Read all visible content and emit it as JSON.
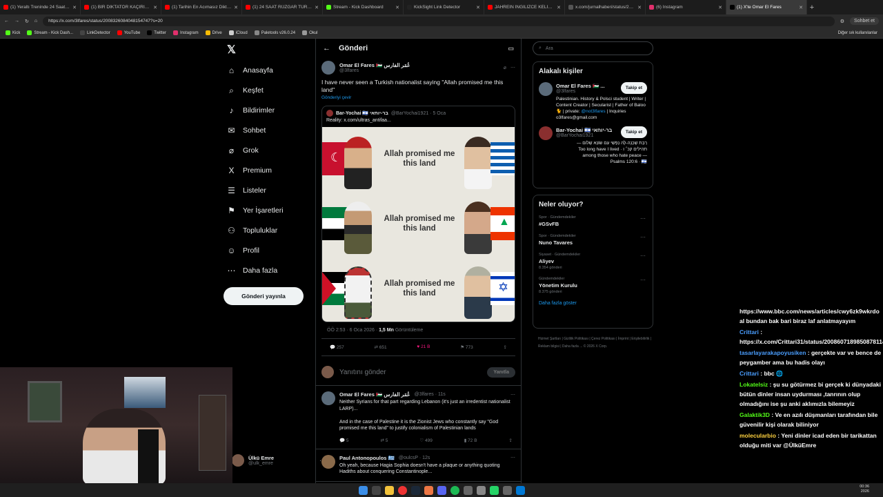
{
  "browser": {
    "tabs": [
      {
        "label": "(1) Yeraltı Treninde 24 Saat Hayat",
        "color": "#ff0000"
      },
      {
        "label": "(1) BİR DİKTATÖR KAÇIRILIRSA NE",
        "color": "#ff0000"
      },
      {
        "label": "(1) Tarihin En Acımasız Diktatör O",
        "color": "#ff0000"
      },
      {
        "label": "(1) 24 SAAT RÜZGAR TÜRBİNİNDE",
        "color": "#ff0000"
      },
      {
        "label": "Stream - Kick Dashboard",
        "color": "#53fc18"
      },
      {
        "label": "KickSight Link Detector",
        "color": "#222222"
      },
      {
        "label": "JAHREİN İNGİLİZCE KELİME TESTİ",
        "color": "#ff0000"
      },
      {
        "label": "x.com/jurnalhaberi/status/2004",
        "color": "#555555"
      },
      {
        "label": "(6) Instagram",
        "color": "#e1306c"
      },
      {
        "label": "(1) X'te Omar El Fares",
        "color": "#000000"
      }
    ],
    "url": "https://x.com/3lfares/status/2008326084048154747?s=20",
    "profile_button": "Sohbet et",
    "bookmarks": [
      {
        "label": "Kick",
        "color": "#53fc18"
      },
      {
        "label": "Stream - Kick Dash...",
        "color": "#53fc18"
      },
      {
        "label": "LinkDetector",
        "color": "#444444"
      },
      {
        "label": "YouTube",
        "color": "#ff0000"
      },
      {
        "label": "Twitter",
        "color": "#000000"
      },
      {
        "label": "Instagram",
        "color": "#e1306c"
      },
      {
        "label": "Drive",
        "color": "#fbbc04"
      },
      {
        "label": "iCloud",
        "color": "#cccccc"
      },
      {
        "label": "Paletools v26.0.24",
        "color": "#888888"
      },
      {
        "label": "Okul",
        "color": "#999999"
      }
    ],
    "other_bookmarks": "Diğer sık kullanılanlar"
  },
  "nav": {
    "items": [
      {
        "label": "Anasayfa",
        "icon": "home-icon",
        "glyph": "⌂"
      },
      {
        "label": "Keşfet",
        "icon": "search-icon",
        "glyph": "⌕"
      },
      {
        "label": "Bildirimler",
        "icon": "bell-icon",
        "glyph": "♪"
      },
      {
        "label": "Sohbet",
        "icon": "mail-icon",
        "glyph": "✉"
      },
      {
        "label": "Grok",
        "icon": "grok-icon",
        "glyph": "⌀"
      },
      {
        "label": "Premium",
        "icon": "x-icon",
        "glyph": "X"
      },
      {
        "label": "Listeler",
        "icon": "list-icon",
        "glyph": "☰"
      },
      {
        "label": "Yer İşaretleri",
        "icon": "bookmark-icon",
        "glyph": "⚑"
      },
      {
        "label": "Topluluklar",
        "icon": "people-icon",
        "glyph": "⚇"
      },
      {
        "label": "Profil",
        "icon": "person-icon",
        "glyph": "☺"
      },
      {
        "label": "Daha fazla",
        "icon": "more-icon",
        "glyph": "⋯"
      }
    ],
    "post_button": "Gönderi yayınla",
    "account": {
      "name": "Ülkü Emre",
      "handle": "@ulk_emre"
    }
  },
  "main": {
    "title": "Gönderi",
    "post": {
      "name": "Omar El Fares 🇵🇸 عُمَر الفارس",
      "handle": "@3lfares",
      "text": "I have never seen a Turkish nationalist saying \"Allah promised me this land\"",
      "translate": "Gönderiyi çevir",
      "quote": {
        "name": "Bar-Yochai 🇮🇱 בר-יוחאי",
        "handle": "@BarYochai1921 · 5 Oca",
        "text": "Reality: x.com/ultras_antifaa...",
        "meme_lines": [
          "Allah promised me this land",
          "Allah promised me this land",
          "Allah promised me this land"
        ]
      },
      "time": "ÖÖ 2:53 · 6 Oca 2026 · ",
      "views_count": "1,5 Mn",
      "views_label": " Görüntüleme",
      "replies": "257",
      "reposts": "651",
      "likes": "21 B",
      "bookmarks": "773"
    },
    "reply_placeholder": "Yanıtını gönder",
    "reply_button": "Yanıtla",
    "comments": [
      {
        "name": "Omar El Fares 🇵🇸 عُمَر الفارس",
        "handle": "@3lfares · 11s",
        "text": "Neither Syrians for that part regarding Lebanon (it's just an irredentist nationalist LARP)...\n\nAnd in the case of Palestine it is the Zionist Jews who constantly say \"God promised me this land\" to justify colonialism of Palestinian lands",
        "replies": "5",
        "reposts": "5",
        "likes": "499",
        "views": "72 B"
      },
      {
        "name": "Paul Antonopoulos 🇬🇷",
        "handle": "@oulcsP · 12s",
        "text": "Oh yeah, because Hagia Sophia doesn't have a plaque or anything quoting Hadiths about conquering Constantinople...",
        "replies": "",
        "reposts": "",
        "likes": "",
        "views": ""
      }
    ]
  },
  "right": {
    "search_placeholder": "Ara",
    "related_title": "Alakalı kişiler",
    "people": [
      {
        "name": "Omar El Fares 🇵🇸 ...",
        "handle": "@3lfares",
        "follow": "Takip et",
        "bio": "Palestinian. History & Polsci student | Writer | Content Creator | Secularist | Father of Baloo 🐈 | private: ",
        "bio_link": "@not3lfares",
        "bio_tail": " | Inquiries o3lfares@gmail.com"
      },
      {
        "name": "Bar-Yochai 🇮🇱 בר-יוחאי",
        "handle": "@BarYochai1921",
        "follow": "Takip et",
        "bio": "— רַבַּת שָׁכְנָה-לָּהּ נַפְשִׁי עִם שׂוֹנֵא שָׁלוֹם\nToo long have I lived · תהילים קכ׳ ו\namong those who hate peace —\nPsalms 120:6 · 🇮🇱",
        "bio_link": "",
        "bio_tail": ""
      }
    ],
    "trends_title": "Neler oluyor?",
    "trends": [
      {
        "category": "Spor · Gündemdekiler",
        "title": "#GSvFB",
        "count": ""
      },
      {
        "category": "Spor · Gündemdekiler",
        "title": "Nuno Tavares",
        "count": ""
      },
      {
        "category": "Siyaset · Gündemdekiler",
        "title": "Aliyev",
        "count": "8.354 gönderi"
      },
      {
        "category": "Gündemdekiler",
        "title": "Yönetim Kurulu",
        "count": "8.375 gönderi"
      }
    ],
    "show_more": "Daha fazla göster",
    "footer": "Hizmet Şartları | Gizlilik Politikası | Çerez Politikası | İmprint | Erişilebilirlik | Reklam bilgisi | Daha fazla ... © 2026 X Corp."
  },
  "chat": [
    {
      "user": "",
      "color": "#ffffff",
      "text": "https://www.bbc.com/news/articles/cwy6zk9wkrdo al bundan bak bari biraz laf anlatmayayım"
    },
    {
      "user": "Crittari",
      "color": "#4a9eff",
      "text": "https://x.com/Crittari31/status/2008607189850878114"
    },
    {
      "user": "tasarlayarakapoyusiken",
      "color": "#4a9eff",
      "text": "gerçekte var ve bence de peygamber ama bu hadis olayı"
    },
    {
      "user": "Crittari",
      "color": "#4a9eff",
      "text": "bbc 🌐"
    },
    {
      "user": "Lokatelsiz",
      "color": "#53fc18",
      "text": "şu su götürmez bi gerçek ki dünyadaki bütün dinler insan uydurması ,tanrının olup olmadığını ise şu anki aklımızla bilemeyiz"
    },
    {
      "user": "Galaktik3D",
      "color": "#53fc18",
      "text": "Ve en azılı düşmanları tarafından bile güvenilir kişi olarak biliniyor"
    },
    {
      "user": "molecularbio",
      "color": "#ffd23f",
      "text": "Yeni dinler icad eden bir tarikattan olduğu miti var @ÜlküEmre"
    }
  ],
  "clock": {
    "time": "00:36",
    "date": "2026"
  }
}
